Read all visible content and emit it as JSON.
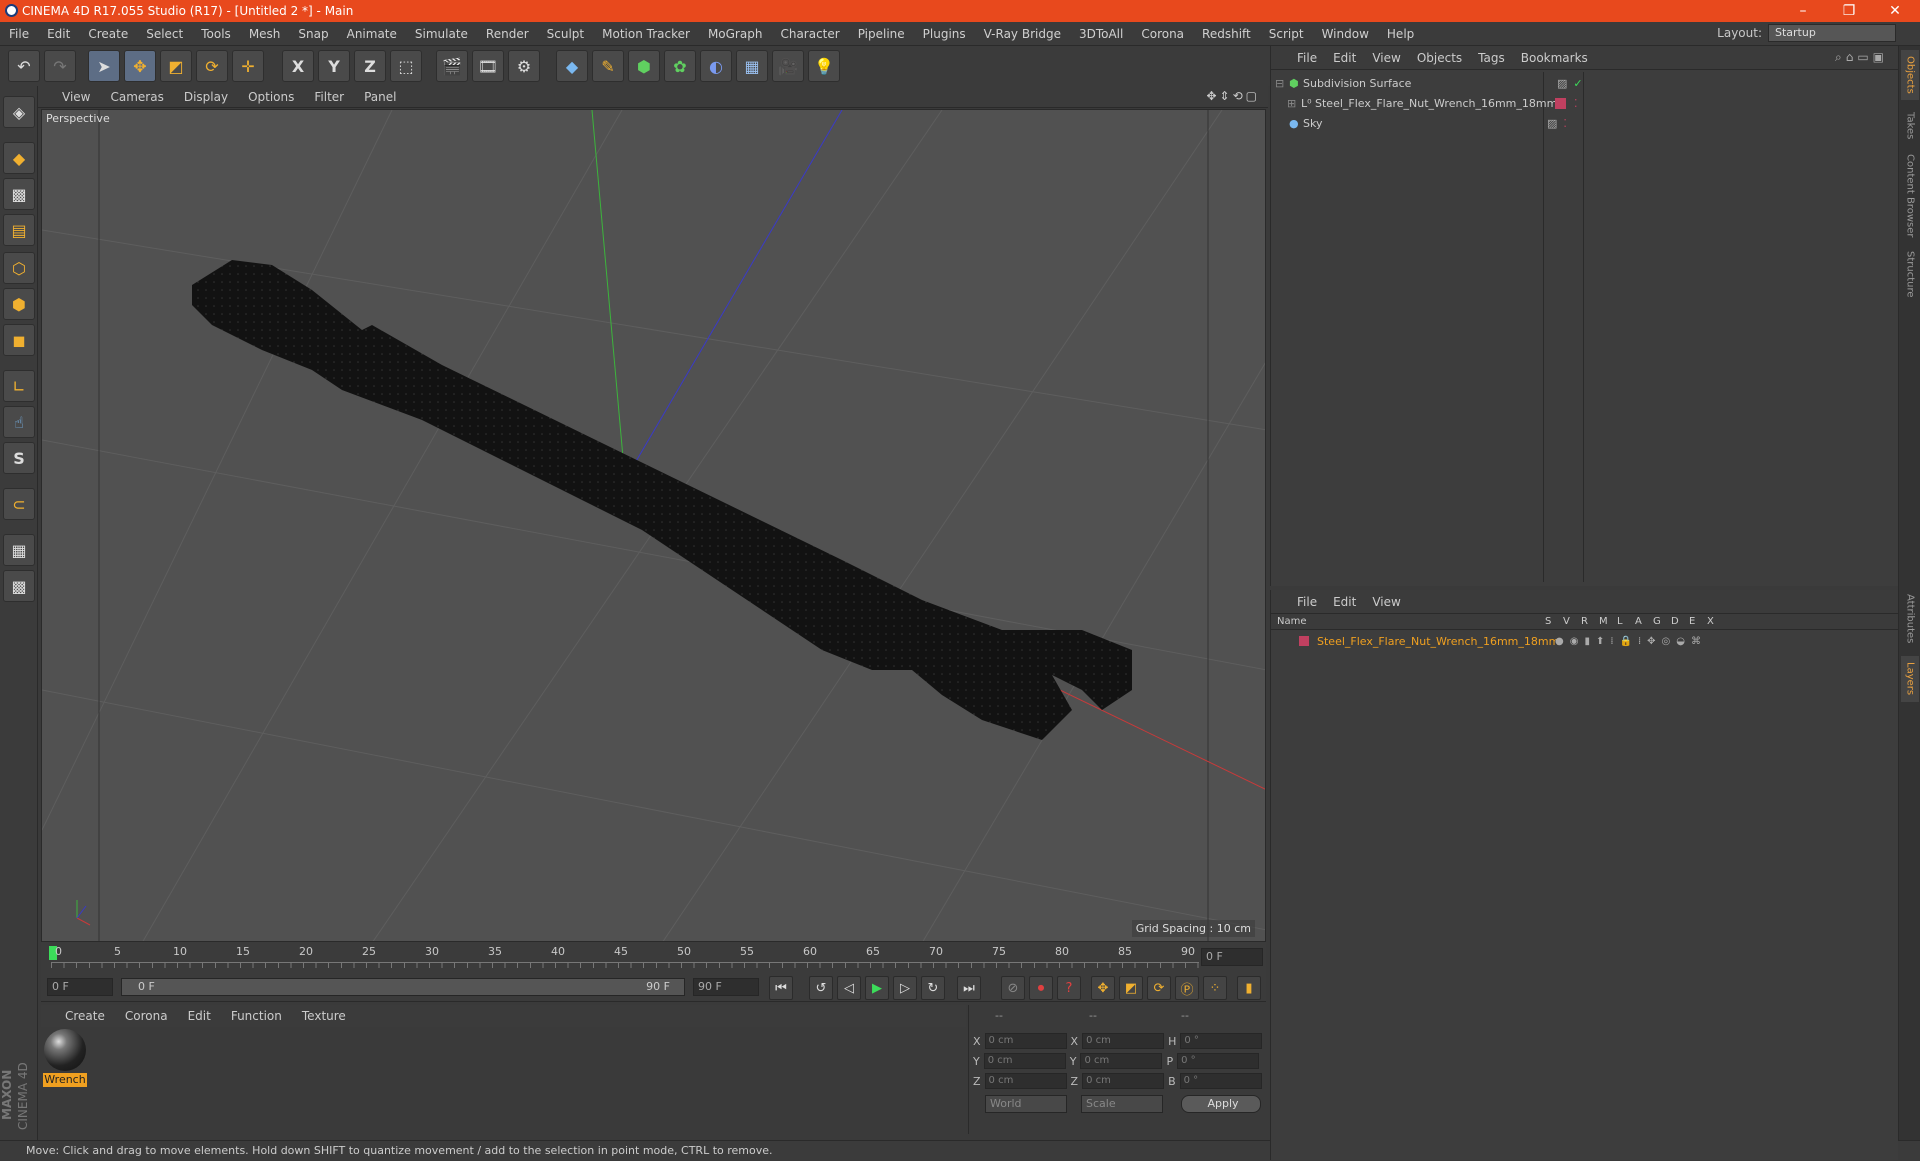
{
  "window": {
    "title": "CINEMA 4D R17.055 Studio (R17) - [Untitled 2 *] - Main",
    "minimize": "–",
    "restore": "❐",
    "close": "✕"
  },
  "menubar": {
    "items": [
      "File",
      "Edit",
      "Create",
      "Select",
      "Tools",
      "Mesh",
      "Snap",
      "Animate",
      "Simulate",
      "Render",
      "Sculpt",
      "Motion Tracker",
      "MoGraph",
      "Character",
      "Pipeline",
      "Plugins",
      "V-Ray Bridge",
      "3DToAll",
      "Corona",
      "Redshift",
      "Script",
      "Window",
      "Help"
    ],
    "layout_label": "Layout:",
    "layout_value": "Startup"
  },
  "toolbar": {
    "axis_x": "X",
    "axis_y": "Y",
    "axis_z": "Z"
  },
  "viewport": {
    "menu": [
      "View",
      "Cameras",
      "Display",
      "Options",
      "Filter",
      "Panel"
    ],
    "label": "Perspective",
    "grid_spacing": "Grid Spacing : 10 cm"
  },
  "timeline": {
    "ticks": [
      "0",
      "5",
      "10",
      "15",
      "20",
      "25",
      "30",
      "35",
      "40",
      "45",
      "50",
      "55",
      "60",
      "65",
      "70",
      "75",
      "80",
      "85",
      "90"
    ],
    "current_frame": "0 F",
    "start_field": "0 F",
    "range_start": "0 F",
    "range_end": "90 F",
    "end_field": "90 F"
  },
  "materials": {
    "menu": [
      "Create",
      "Corona",
      "Edit",
      "Function",
      "Texture"
    ],
    "items": [
      {
        "name": "Wrench"
      }
    ]
  },
  "coords": {
    "headers": [
      "--",
      "--",
      "--"
    ],
    "rows": [
      {
        "l1": "X",
        "v1": "0 cm",
        "l2": "X",
        "v2": "0 cm",
        "l3": "H",
        "v3": "0 °"
      },
      {
        "l1": "Y",
        "v1": "0 cm",
        "l2": "Y",
        "v2": "0 cm",
        "l3": "P",
        "v3": "0 °"
      },
      {
        "l1": "Z",
        "v1": "0 cm",
        "l2": "Z",
        "v2": "0 cm",
        "l3": "B",
        "v3": "0 °"
      }
    ],
    "world": "World",
    "scale": "Scale",
    "apply": "Apply"
  },
  "objects": {
    "menu": [
      "File",
      "Edit",
      "View",
      "Objects",
      "Tags",
      "Bookmarks"
    ],
    "items": [
      {
        "name": "Subdivision Surface"
      },
      {
        "name": "Steel_Flex_Flare_Nut_Wrench_16mm_18mm"
      },
      {
        "name": "Sky"
      }
    ]
  },
  "layers": {
    "menu": [
      "File",
      "Edit",
      "View"
    ],
    "name_header": "Name",
    "cols": [
      "S",
      "V",
      "R",
      "M",
      "L",
      "A",
      "G",
      "D",
      "E",
      "X"
    ],
    "items": [
      {
        "name": "Steel_Flex_Flare_Nut_Wrench_16mm_18mm"
      }
    ]
  },
  "right_tabs": [
    "Objects",
    "Takes",
    "Content Browser",
    "Structure",
    "Attributes",
    "Layers"
  ],
  "status": "Move: Click and drag to move elements. Hold down SHIFT to quantize movement / add to the selection in point mode, CTRL to remove.",
  "brand": {
    "line1": "MAXON",
    "line2": "CINEMA 4D"
  }
}
